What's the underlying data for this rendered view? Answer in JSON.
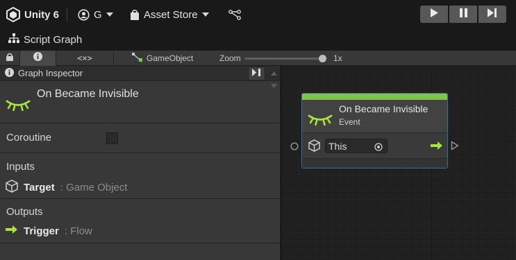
{
  "toolbar": {
    "product": "Unity 6",
    "account": "G",
    "asset_store": "Asset Store"
  },
  "window": {
    "title": "Script Graph"
  },
  "graph_toolbar": {
    "breadcrumb": "GameObject",
    "zoom_label": "Zoom",
    "zoom_value": "1x",
    "zoom_level": 0.95
  },
  "inspector": {
    "title": "Graph Inspector",
    "event_name": "On Became Invisible",
    "coroutine_label": "Coroutine",
    "coroutine_checked": false,
    "inputs_label": "Inputs",
    "input_port": {
      "name": "Target",
      "type": ": Game Object"
    },
    "outputs_label": "Outputs",
    "output_port": {
      "name": "Trigger",
      "type": ": Flow"
    }
  },
  "node": {
    "title": "On Became Invisible",
    "subtitle": "Event",
    "field_value": "This"
  },
  "colors": {
    "accent_green": "#7fc44c",
    "node_border": "#3b6e93",
    "panel": "#383838",
    "canvas": "#202020"
  },
  "icons": [
    "unity-logo-icon",
    "account-icon",
    "store-bag-icon",
    "version-control-icon",
    "play-icon",
    "pause-icon",
    "step-icon",
    "hierarchy-icon",
    "lock-icon",
    "info-icon",
    "variables-icon",
    "gameobject-icon",
    "eye-closed-icon",
    "cube-icon",
    "flow-arrow-icon",
    "target-icon"
  ]
}
